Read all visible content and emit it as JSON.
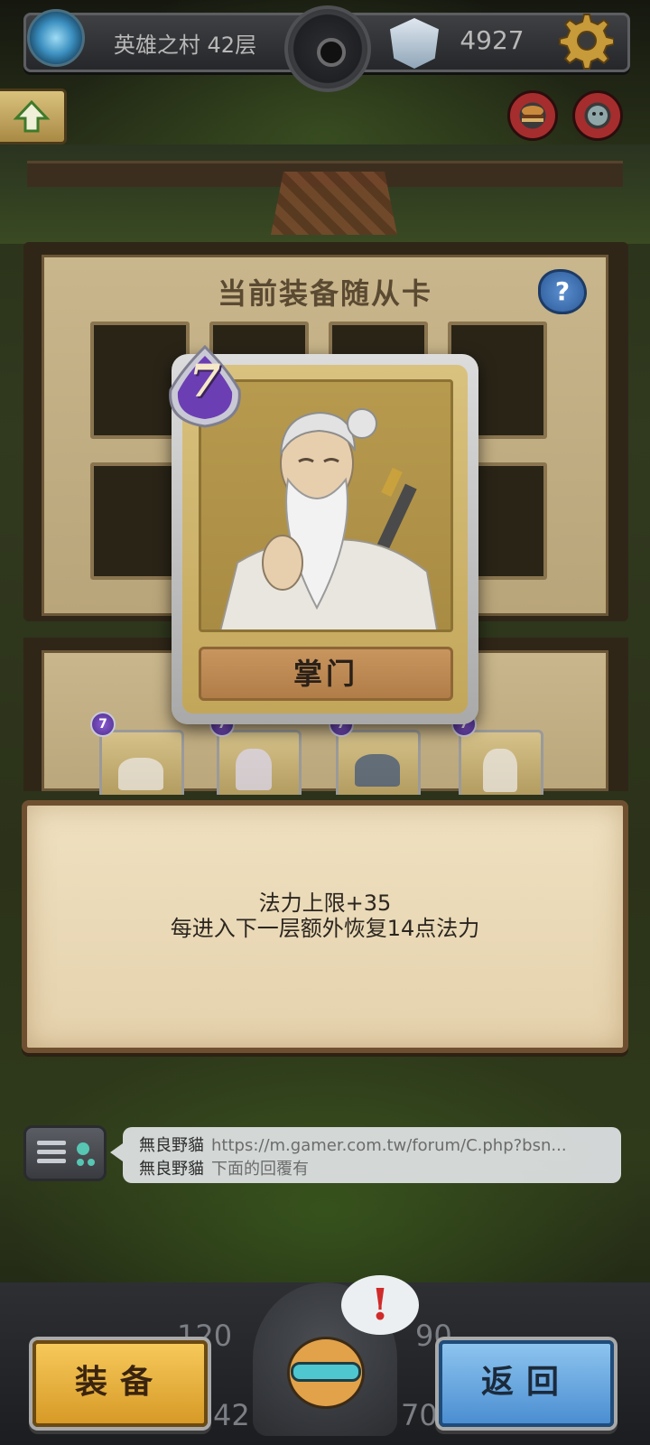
{
  "header": {
    "floor_label": "英雄之村 42层",
    "gem_count": "4927",
    "portal_icon": "portal-icon",
    "gem_icon": "crystal-mask-icon",
    "settings_icon": "gear-icon"
  },
  "side_buttons": {
    "back_icon": "up-arrow-icon",
    "round_1_icon": "burger-icon",
    "round_2_icon": "creature-icon"
  },
  "board": {
    "title": "当前装备随从卡",
    "help_label": "?"
  },
  "card": {
    "cost": "7",
    "name": "掌门"
  },
  "mini_cards": [
    {
      "cost": "7"
    },
    {
      "cost": "7"
    },
    {
      "cost": "7"
    },
    {
      "cost": "7"
    }
  ],
  "description": {
    "line1": "法力上限+35",
    "line2": "每进入下一层额外恢复14点法力"
  },
  "chat": {
    "messages": [
      {
        "user": "無良野貓",
        "text": "https://m.gamer.com.tw/forum/C.php?bsn..."
      },
      {
        "user": "無良野貓",
        "text": "下面的回覆有"
      }
    ]
  },
  "hud": {
    "stat_top_left": "120",
    "stat_top_right": "90",
    "stat_bottom_left": "42",
    "stat_bottom_right": "70",
    "alert": "!"
  },
  "buttons": {
    "equip": "装备",
    "return": "返回"
  },
  "colors": {
    "equip_button": "#e0aa3a",
    "return_button": "#6aa9e0",
    "cost_gem": "#6b3fb3"
  }
}
